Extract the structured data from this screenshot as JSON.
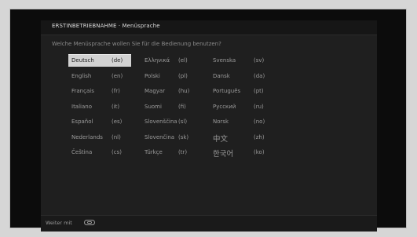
{
  "header": {
    "title": "ERSTINBETRIEBNAHME · Menüsprache",
    "question": "Welche Menüsprache wollen Sie für die Bedienung benutzen?"
  },
  "languages": [
    {
      "name": "Deutsch",
      "code": "(de)",
      "selected": true
    },
    {
      "name": "English",
      "code": "(en)"
    },
    {
      "name": "Français",
      "code": "(fr)"
    },
    {
      "name": "Italiano",
      "code": "(it)"
    },
    {
      "name": "Español",
      "code": "(es)"
    },
    {
      "name": "Nederlands",
      "code": "(nl)"
    },
    {
      "name": "Čeština",
      "code": "(cs)"
    },
    {
      "name": "Ελληνικά",
      "code": "(el)"
    },
    {
      "name": "Polski",
      "code": "(pl)"
    },
    {
      "name": "Magyar",
      "code": "(hu)"
    },
    {
      "name": "Suomi",
      "code": "(fi)"
    },
    {
      "name": "Slovenščina",
      "code": "(sl)"
    },
    {
      "name": "Slovenčina",
      "code": "(sk)"
    },
    {
      "name": "Türkçe",
      "code": "(tr)"
    },
    {
      "name": "Svenska",
      "code": "(sv)"
    },
    {
      "name": "Dansk",
      "code": "(da)"
    },
    {
      "name": "Português",
      "code": "(pt)"
    },
    {
      "name": "Русский",
      "code": "(ru)"
    },
    {
      "name": "Norsk",
      "code": "(no)"
    },
    {
      "name": "中文",
      "code": "(zh)"
    },
    {
      "name": "한국어",
      "code": "(ko)"
    }
  ],
  "footer": {
    "label": "Weiter mit",
    "icon": "ok-button-icon"
  },
  "colors": {
    "panel": "#1f1f1f",
    "selected_bg": "#d2d2d2",
    "text": "#9b9b9b"
  }
}
